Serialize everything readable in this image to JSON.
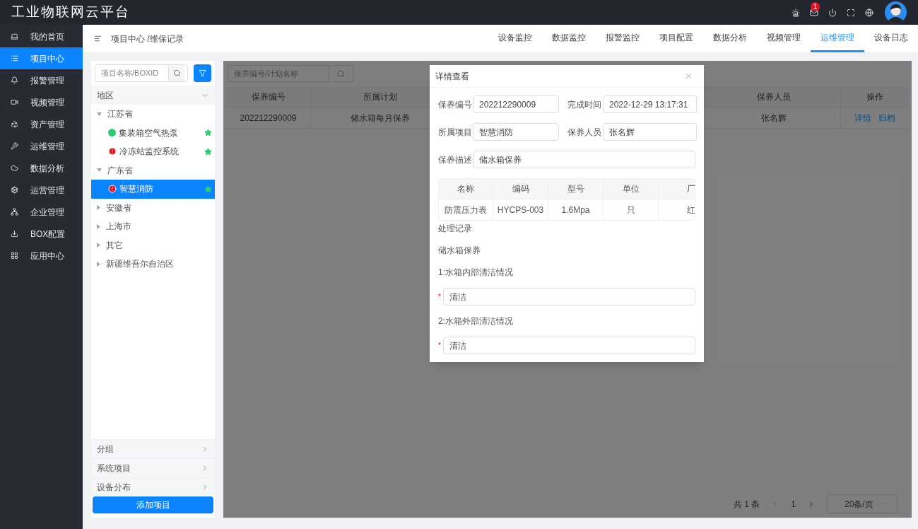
{
  "app": {
    "title": "工业物联网云平台",
    "notification_count": "1"
  },
  "sidebar": {
    "items": [
      {
        "label": "我的首页",
        "selected": false
      },
      {
        "label": "项目中心",
        "selected": true
      },
      {
        "label": "报警管理",
        "selected": false
      },
      {
        "label": "视频管理",
        "selected": false
      },
      {
        "label": "资产管理",
        "selected": false
      },
      {
        "label": "运维管理",
        "selected": false
      },
      {
        "label": "数据分析",
        "selected": false
      },
      {
        "label": "运营管理",
        "selected": false
      },
      {
        "label": "企业管理",
        "selected": false
      },
      {
        "label": "BOX配置",
        "selected": false
      },
      {
        "label": "应用中心",
        "selected": false
      }
    ]
  },
  "breadcrumb": "项目中心 /维保记录",
  "tabs": [
    {
      "label": "设备监控",
      "selected": false
    },
    {
      "label": "数据监控",
      "selected": false
    },
    {
      "label": "报警监控",
      "selected": false
    },
    {
      "label": "项目配置",
      "selected": false
    },
    {
      "label": "数据分析",
      "selected": false
    },
    {
      "label": "视频管理",
      "selected": false
    },
    {
      "label": "运维管理",
      "selected": true
    },
    {
      "label": "设备日志",
      "selected": false
    }
  ],
  "project_panel": {
    "search": {
      "placeholder": "项目名称/BOXID"
    },
    "region_header": "地区",
    "tree": [
      {
        "label": "江苏省",
        "expanded": true,
        "children": [
          {
            "label": "集装箱空气热泵",
            "kind": "ok",
            "starred": true,
            "selected": false
          },
          {
            "label": "冷冻站监控系统",
            "kind": "alert",
            "starred": true,
            "selected": false
          }
        ]
      },
      {
        "label": "广东省",
        "expanded": true,
        "children": [
          {
            "label": "智慧消防",
            "kind": "alert",
            "starred": true,
            "selected": true
          }
        ]
      },
      {
        "label": "安徽省",
        "expanded": false
      },
      {
        "label": "上海市",
        "expanded": false
      },
      {
        "label": "其它",
        "expanded": false
      },
      {
        "label": "新疆维吾尔自治区",
        "expanded": false
      }
    ],
    "sections": [
      "分组",
      "系统项目",
      "设备分布"
    ],
    "add_button": "添加项目"
  },
  "records": {
    "search": {
      "placeholder": "保养编号/计划名称"
    },
    "columns": [
      "保养编号",
      "所属计划",
      "保养人员",
      "操作"
    ],
    "rows": [
      {
        "cells": [
          "202212290009",
          "储水箱每月保养",
          "张名辉"
        ],
        "actions": [
          "详情",
          "归档"
        ]
      }
    ],
    "pagination": {
      "total": "共 1 条",
      "page": "1",
      "page_size": "20条/页"
    }
  },
  "dialog": {
    "title": "详情查看",
    "fields": [
      {
        "label": "保养编号",
        "value": "202212290009"
      },
      {
        "label": "完成时间",
        "value": "2022-12-29 13:17:31"
      },
      {
        "label": "所属项目",
        "value": "智慧消防"
      },
      {
        "label": "保养人员",
        "value": "张名辉"
      }
    ],
    "description": {
      "label": "保养描述",
      "value": "储水箱保养"
    },
    "parts": {
      "columns": [
        "名称",
        "编码",
        "型号",
        "单位",
        "厂"
      ],
      "rows": [
        [
          "防震压力表",
          "HYCPS-003",
          "1.6Mpa",
          "只",
          "红"
        ]
      ]
    },
    "record_title": "处理记录",
    "record_name": "储水箱保养",
    "items": [
      {
        "question": "1:水箱内部清洁情况",
        "answer": "清洁",
        "required_mark": "*"
      },
      {
        "question": "2:水箱外部清洁情况",
        "answer": "清洁",
        "required_mark": "*"
      }
    ]
  }
}
